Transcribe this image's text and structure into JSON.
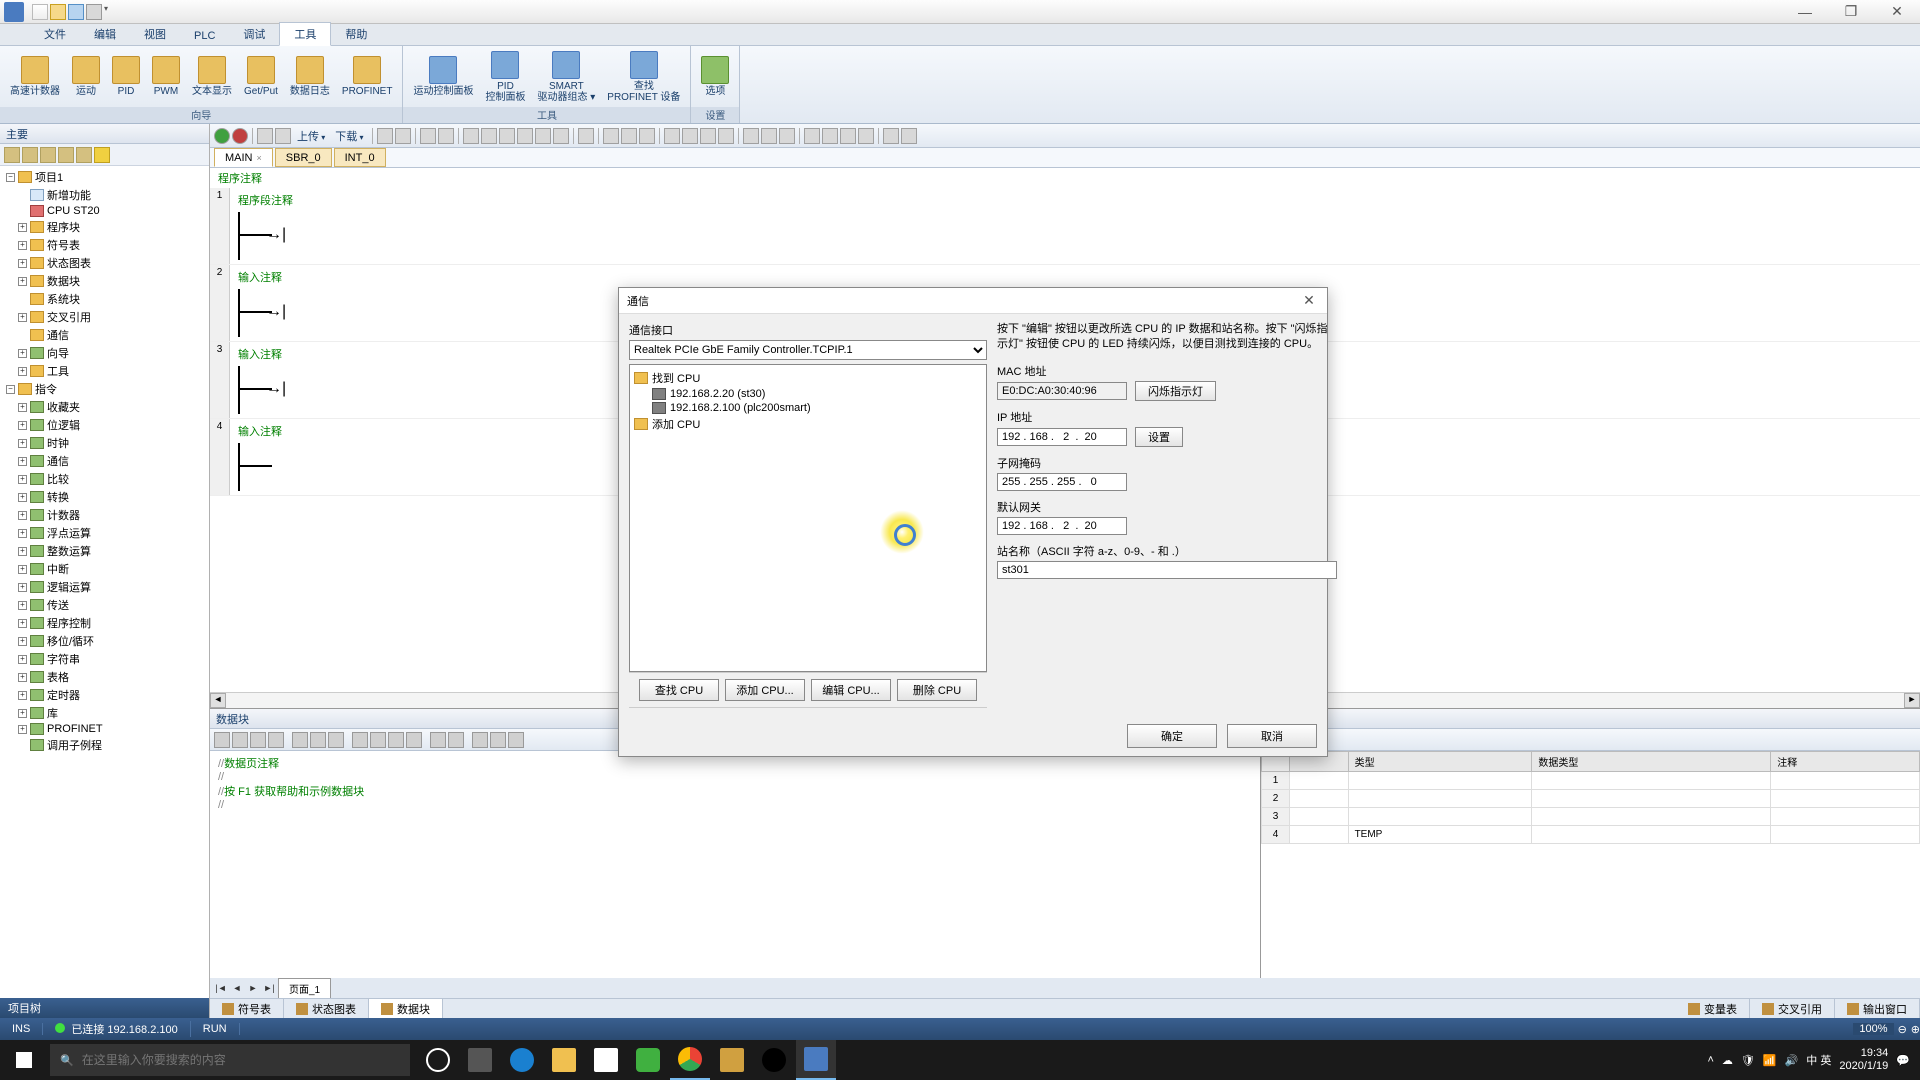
{
  "menu": {
    "file": "文件",
    "edit": "编辑",
    "view": "视图",
    "plc": "PLC",
    "debug": "调试",
    "tools": "工具",
    "help": "帮助"
  },
  "ribbon": {
    "g1": {
      "label": "向导",
      "items": [
        "高速计数器",
        "运动",
        "PID",
        "PWM",
        "文本显示",
        "Get/Put",
        "数据日志",
        "PROFINET"
      ]
    },
    "g2": {
      "label": "工具",
      "items": [
        "运动控制面板",
        "PID\n控制面板",
        "SMART\n驱动器组态 ▾",
        "查找\nPROFINET 设备"
      ]
    },
    "g3": {
      "label": "设置",
      "items": [
        "选项"
      ]
    }
  },
  "leftpanel": {
    "title": "主要",
    "bottom": "项目树"
  },
  "tree": {
    "proj": "项目1",
    "items": [
      "新增功能",
      "CPU ST20",
      "程序块",
      "符号表",
      "状态图表",
      "数据块",
      "系统块",
      "交叉引用",
      "通信",
      "向导",
      "工具"
    ],
    "instr_root": "指令",
    "instr": [
      "收藏夹",
      "位逻辑",
      "时钟",
      "通信",
      "比较",
      "转换",
      "计数器",
      "浮点运算",
      "整数运算",
      "中断",
      "逻辑运算",
      "传送",
      "程序控制",
      "移位/循环",
      "字符串",
      "表格",
      "定时器",
      "库",
      "PROFINET",
      "调用子例程"
    ]
  },
  "edtabs": {
    "main": "MAIN",
    "sbr": "SBR_0",
    "int": "INT_0"
  },
  "edtool": {
    "upload": "上传",
    "download": "下载"
  },
  "ladder": {
    "prog_cmt": "程序注释",
    "seg_cmt": "程序段注释",
    "input_cmt": "输入注释"
  },
  "datablk": {
    "title": "数据块",
    "l1": "数据页注释",
    "l2": "按  F1  获取帮助和示例数据块",
    "page": "页面_1"
  },
  "rtbl": {
    "h2": "类型",
    "h3": "数据类型",
    "h4": "注释",
    "temp": "TEMP"
  },
  "btabs": {
    "sym": "符号表",
    "stat": "状态图表",
    "data": "数据块",
    "var": "变量表",
    "xref": "交叉引用",
    "out": "输出窗口"
  },
  "status": {
    "ins": "INS",
    "conn": "已连接 192.168.2.100",
    "run": "RUN",
    "zoom": "100%"
  },
  "dialog": {
    "title": "通信",
    "iface_lbl": "通信接口",
    "iface": "Realtek PCIe GbE Family Controller.TCPIP.1",
    "found": "找到 CPU",
    "cpu1": "192.168.2.20 (st30)",
    "cpu2": "192.168.2.100 (plc200smart)",
    "add": "添加 CPU",
    "help": "按下 \"编辑\" 按钮以更改所选 CPU 的 IP 数据和站名称。按下 \"闪烁指示灯\" 按钮使 CPU 的 LED 持续闪烁，以便目测找到连接的 CPU。",
    "mac_lbl": "MAC 地址",
    "mac": "E0:DC:A0:30:40:96",
    "flash": "闪烁指示灯",
    "ip_lbl": "IP 地址",
    "ip": "192 . 168 .   2  .  20",
    "set": "设置",
    "mask_lbl": "子网掩码",
    "mask": "255 . 255 . 255 .   0",
    "gw_lbl": "默认网关",
    "gw": "192 . 168 .   2  .  20",
    "name_lbl": "站名称（ASCII 字符 a-z、0-9、- 和 .）",
    "name": "st301",
    "find": "查找 CPU",
    "addcpu": "添加 CPU...",
    "editcpu": "编辑 CPU...",
    "delcpu": "删除 CPU",
    "ok": "确定",
    "cancel": "取消"
  },
  "taskbar": {
    "search": "在这里输入你要搜索的内容",
    "ime": "中 英",
    "time": "19:34",
    "date": "2020/1/19"
  }
}
